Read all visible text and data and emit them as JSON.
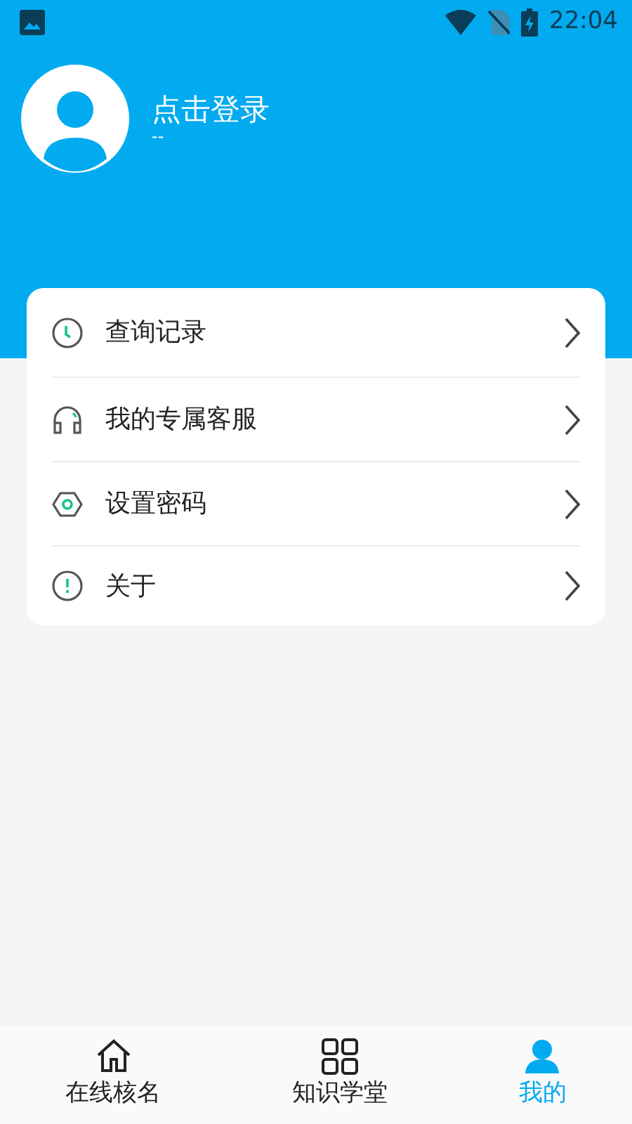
{
  "status_bar": {
    "time": "22:04"
  },
  "profile": {
    "name": "点击登录",
    "subtitle": "--"
  },
  "menu": [
    {
      "kind": "history",
      "label": "查询记录"
    },
    {
      "kind": "service",
      "label": "我的专属客服"
    },
    {
      "kind": "password",
      "label": "设置密码"
    },
    {
      "kind": "about",
      "label": "关于"
    }
  ],
  "tabs": [
    {
      "kind": "home",
      "label": "在线核名",
      "selected": false
    },
    {
      "kind": "grid",
      "label": "知识学堂",
      "selected": false
    },
    {
      "kind": "user",
      "label": "我的",
      "selected": true
    }
  ]
}
